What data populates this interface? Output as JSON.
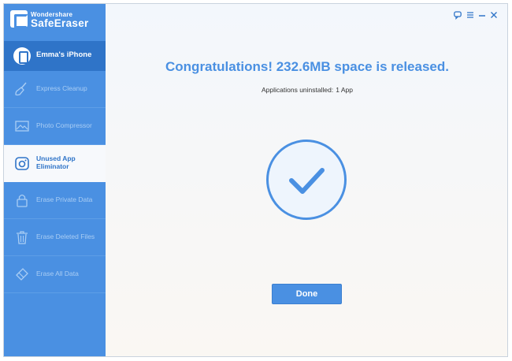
{
  "app": {
    "brand_small": "Wondershare",
    "brand_name": "SafeEraser"
  },
  "device": {
    "name": "Emma's iPhone",
    "icon": "iphone-icon"
  },
  "sidebar": {
    "items": [
      {
        "label": "Express Cleanup",
        "icon": "broom-icon",
        "active": false
      },
      {
        "label": "Photo Compressor",
        "icon": "image-icon",
        "active": false
      },
      {
        "label": "Unused App Eliminator",
        "icon": "app-camera-icon",
        "active": true
      },
      {
        "label": "Erase Private Data",
        "icon": "lock-icon",
        "active": false
      },
      {
        "label": "Erase Deleted Files",
        "icon": "trash-icon",
        "active": false
      },
      {
        "label": "Erase All Data",
        "icon": "eraser-icon",
        "active": false
      }
    ]
  },
  "window_controls": [
    "feedback-icon",
    "menu-icon",
    "minimize-icon",
    "close-icon"
  ],
  "result": {
    "headline": "Congratulations! 232.6MB space is released.",
    "sub_label": "Applications uninstalled:",
    "sub_value": "1 App",
    "status_icon": "checkmark-icon",
    "done_label": "Done"
  },
  "colors": {
    "accent": "#4a90e2",
    "sidebar_active": "#2f74c8",
    "sidebar_text": "#a9cdf4"
  }
}
